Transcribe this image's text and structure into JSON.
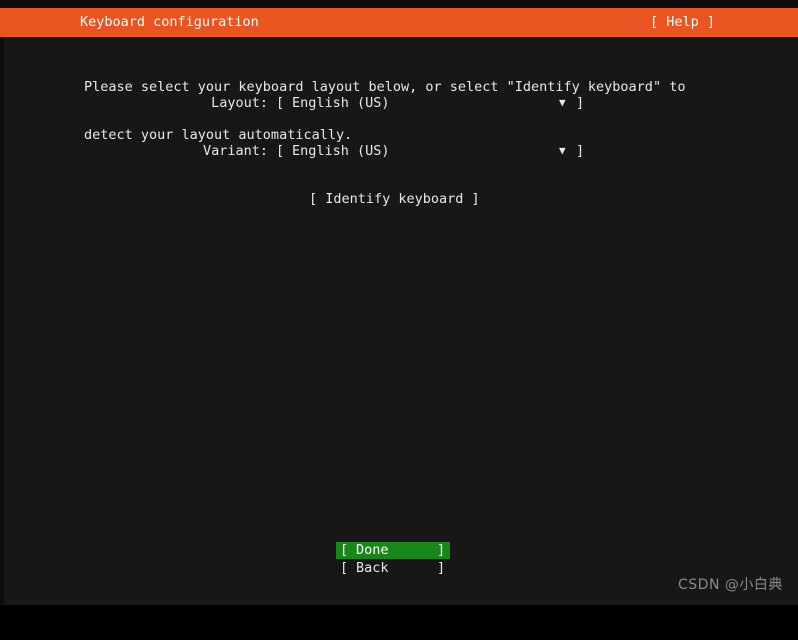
{
  "colors": {
    "background": "#171717",
    "frame": "#0d0d0d",
    "header_bg": "#e95420",
    "header_fg": "#ffffff",
    "text": "#e8e8e8",
    "selected_bg": "#18871a",
    "selected_fg": "#ffffff",
    "watermark": "#8a8a8a"
  },
  "header": {
    "title": "Keyboard configuration",
    "help_label": "[ Help ]"
  },
  "main": {
    "intro_line1": "Please select your keyboard layout below, or select \"Identify keyboard\" to",
    "intro_line2": "detect your layout automatically.",
    "fields": [
      {
        "name": "layout",
        "label": "Layout:",
        "bracket_open": "[",
        "value": "English (US)",
        "caret": "▼",
        "bracket_close": "]"
      },
      {
        "name": "variant",
        "label": "Variant:",
        "bracket_open": "[",
        "value": "English (US)",
        "caret": "▼",
        "bracket_close": "]"
      }
    ],
    "identify_button": "[ Identify keyboard ]"
  },
  "footer": {
    "buttons": [
      {
        "name": "done",
        "bracket_open": "[",
        "label": "Done",
        "bracket_close": "]",
        "selected": true
      },
      {
        "name": "back",
        "bracket_open": "[",
        "label": "Back",
        "bracket_close": "]",
        "selected": false
      }
    ]
  },
  "watermark": {
    "text": "CSDN @小白典"
  }
}
